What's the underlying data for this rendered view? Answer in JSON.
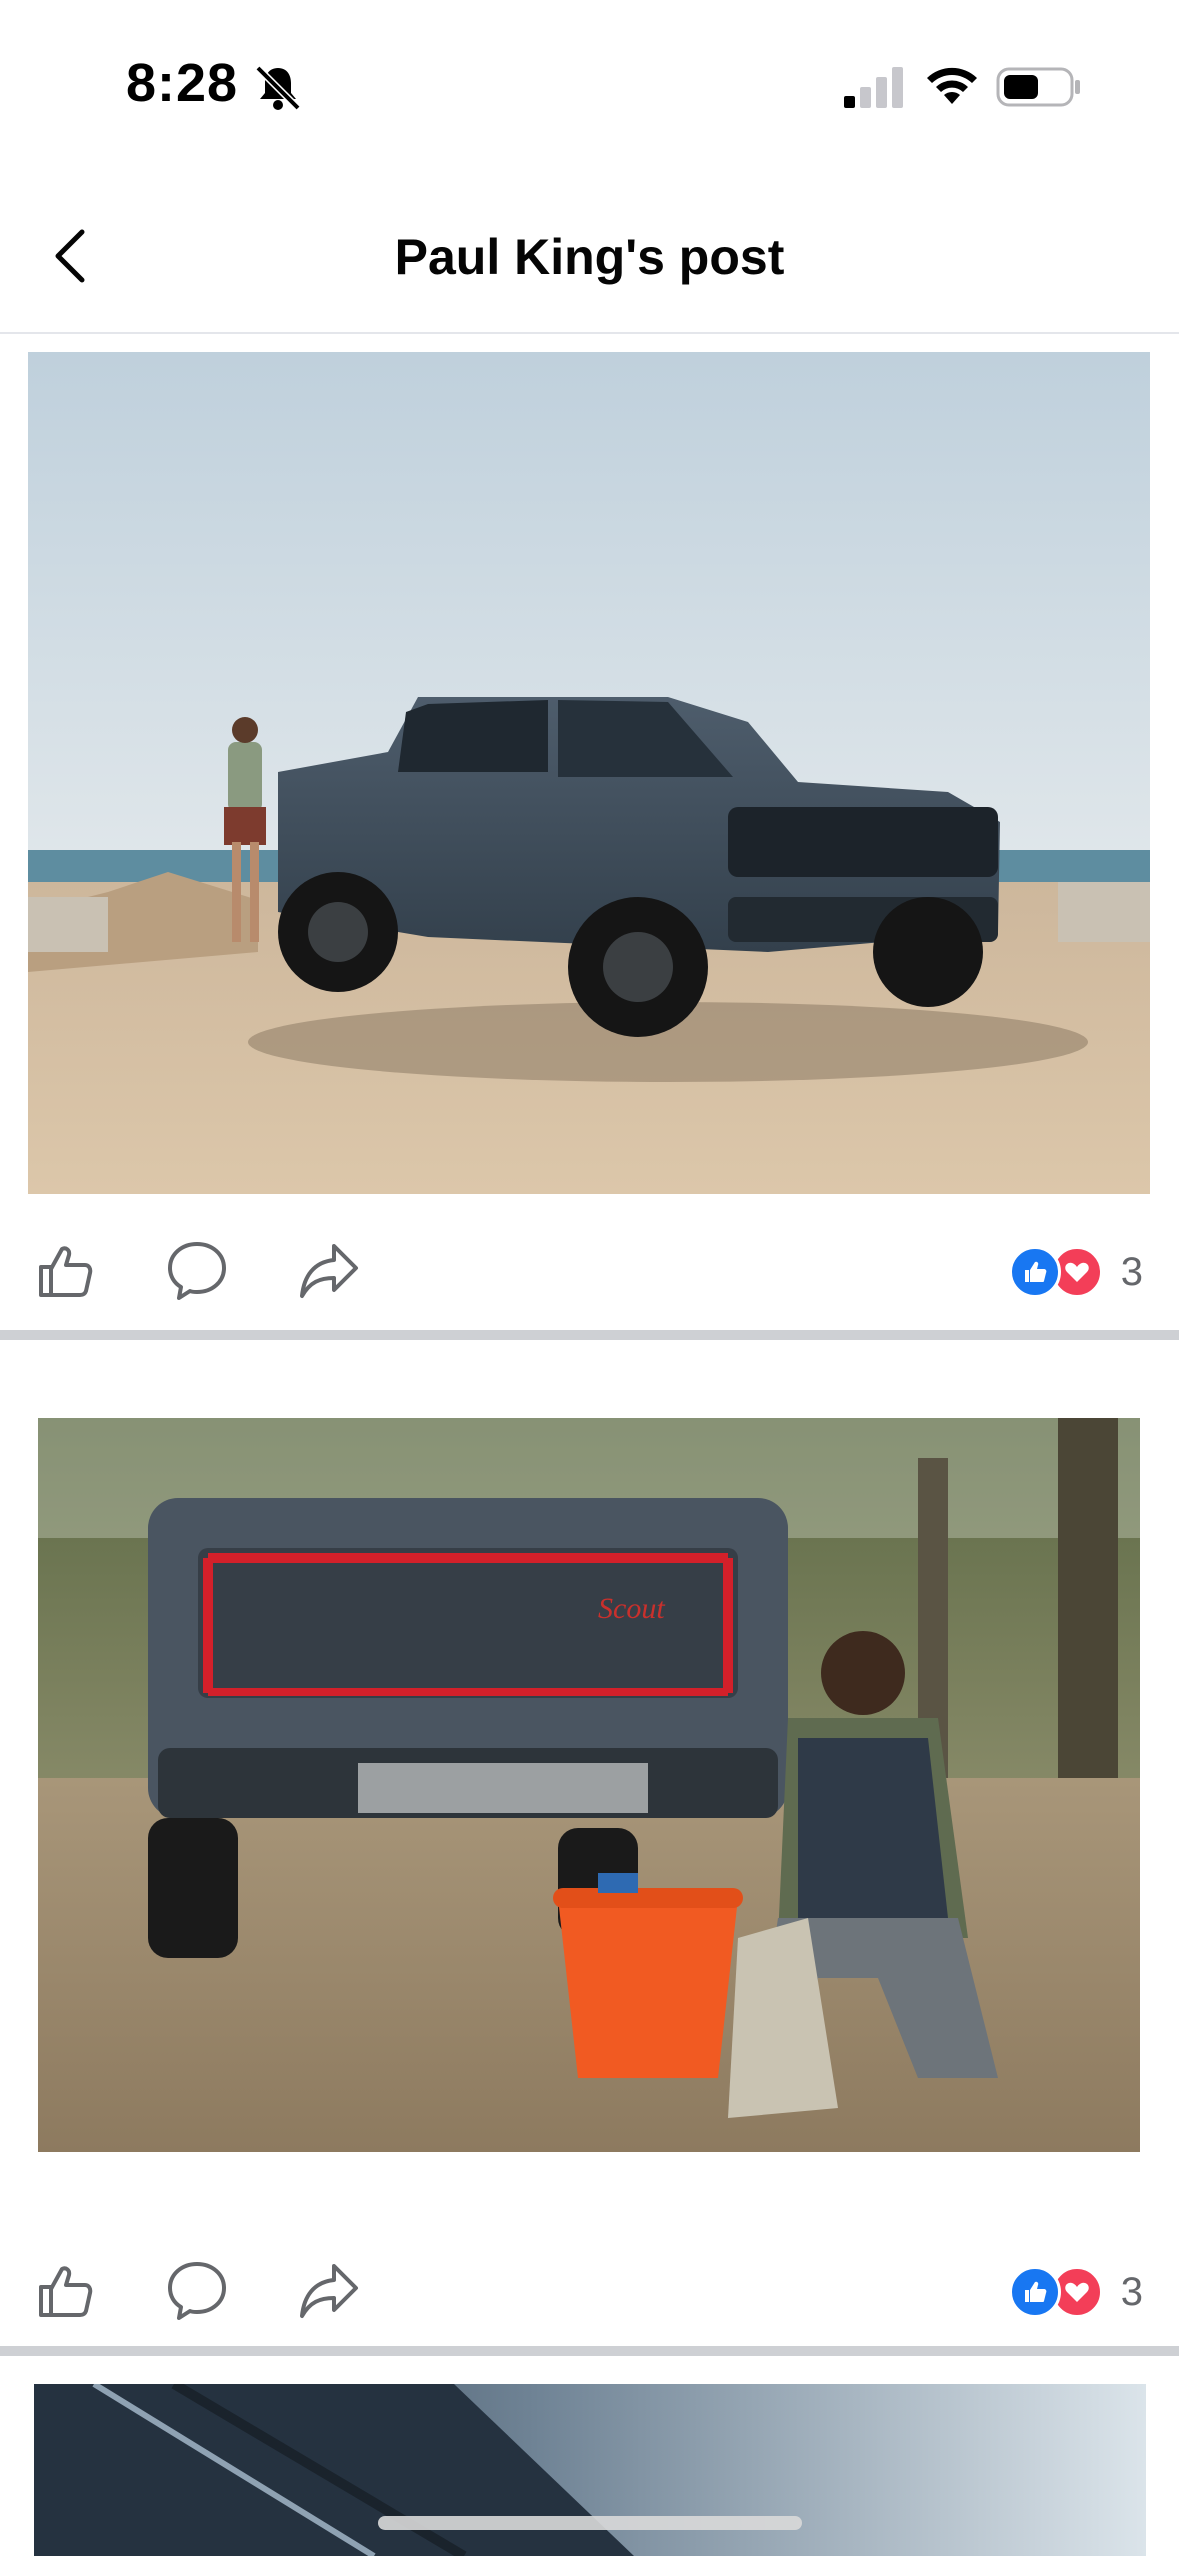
{
  "status_bar": {
    "time": "8:28",
    "icons": [
      "bell-off-icon",
      "signal-icon",
      "wifi-icon",
      "battery-icon"
    ]
  },
  "header": {
    "title": "Paul King's post",
    "back_icon": "chevron-left-icon"
  },
  "posts": [
    {
      "photo_subject": "pickup-truck-on-beach",
      "actions": [
        "like-icon",
        "comment-icon",
        "share-icon"
      ],
      "reactions": {
        "icons": [
          "like-reaction-icon",
          "love-reaction-icon"
        ],
        "count": "3"
      }
    },
    {
      "photo_subject": "truck-rear-with-man-and-basket",
      "actions": [
        "like-icon",
        "comment-icon",
        "share-icon"
      ],
      "reactions": {
        "icons": [
          "like-reaction-icon",
          "love-reaction-icon"
        ],
        "count": "3"
      }
    },
    {
      "photo_subject": "truck-detail-partial"
    }
  ],
  "colors": {
    "facebook_blue": "#1877f2",
    "love_red": "#f33e58",
    "separator": "#ced0d4",
    "secondary_text": "#65676b"
  }
}
